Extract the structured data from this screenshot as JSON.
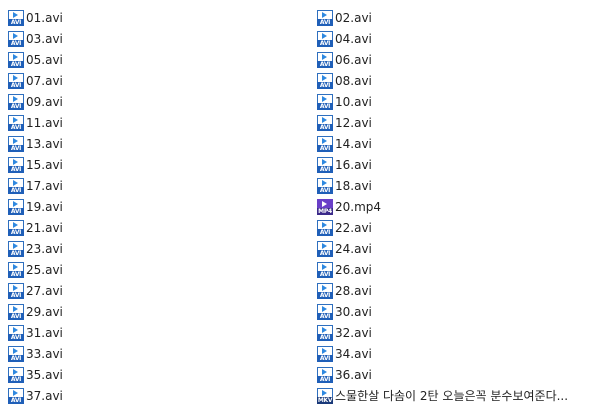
{
  "files": [
    {
      "name": "01.avi",
      "type": "AVI"
    },
    {
      "name": "02.avi",
      "type": "AVI"
    },
    {
      "name": "03.avi",
      "type": "AVI"
    },
    {
      "name": "04.avi",
      "type": "AVI"
    },
    {
      "name": "05.avi",
      "type": "AVI"
    },
    {
      "name": "06.avi",
      "type": "AVI"
    },
    {
      "name": "07.avi",
      "type": "AVI"
    },
    {
      "name": "08.avi",
      "type": "AVI"
    },
    {
      "name": "09.avi",
      "type": "AVI"
    },
    {
      "name": "10.avi",
      "type": "AVI"
    },
    {
      "name": "11.avi",
      "type": "AVI"
    },
    {
      "name": "12.avi",
      "type": "AVI"
    },
    {
      "name": "13.avi",
      "type": "AVI"
    },
    {
      "name": "14.avi",
      "type": "AVI"
    },
    {
      "name": "15.avi",
      "type": "AVI"
    },
    {
      "name": "16.avi",
      "type": "AVI"
    },
    {
      "name": "17.avi",
      "type": "AVI"
    },
    {
      "name": "18.avi",
      "type": "AVI"
    },
    {
      "name": "19.avi",
      "type": "AVI"
    },
    {
      "name": "20.mp4",
      "type": "MP4"
    },
    {
      "name": "21.avi",
      "type": "AVI"
    },
    {
      "name": "22.avi",
      "type": "AVI"
    },
    {
      "name": "23.avi",
      "type": "AVI"
    },
    {
      "name": "24.avi",
      "type": "AVI"
    },
    {
      "name": "25.avi",
      "type": "AVI"
    },
    {
      "name": "26.avi",
      "type": "AVI"
    },
    {
      "name": "27.avi",
      "type": "AVI"
    },
    {
      "name": "28.avi",
      "type": "AVI"
    },
    {
      "name": "29.avi",
      "type": "AVI"
    },
    {
      "name": "30.avi",
      "type": "AVI"
    },
    {
      "name": "31.avi",
      "type": "AVI"
    },
    {
      "name": "32.avi",
      "type": "AVI"
    },
    {
      "name": "33.avi",
      "type": "AVI"
    },
    {
      "name": "34.avi",
      "type": "AVI"
    },
    {
      "name": "35.avi",
      "type": "AVI"
    },
    {
      "name": "36.avi",
      "type": "AVI"
    },
    {
      "name": "37.avi",
      "type": "AVI"
    },
    {
      "name": "스물한살 다솜이 2탄 오늘은꼭 분수보여준다...",
      "type": "MKV"
    }
  ],
  "icon_colors": {
    "avi_band": "#1f5fb8",
    "mp4_band": "#3b2a8a",
    "mkv_band": "#1a3a7a",
    "play": "#2e88e0",
    "mp4_accent": "#6a3fc8"
  }
}
